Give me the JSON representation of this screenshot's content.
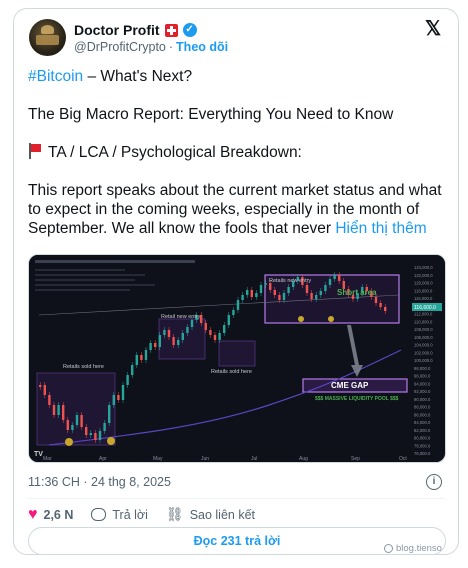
{
  "author": {
    "display_name": "Doctor Profit",
    "handle": "@DrProfitCrypto",
    "follow_label": "Theo dõi",
    "separator": "·"
  },
  "tweet": {
    "hashtag": "#Bitcoin",
    "line1_rest": " – What's Next?",
    "line2": "The Big Macro Report: Everything You Need to Know",
    "line3": "TA / LCA / Psychological Breakdown:",
    "line4": "This report speaks about the current market status and what to expect in the coming weeks, especially in the month of September. We all know the fools that never ",
    "show_more": "Hiển thị thêm"
  },
  "chart": {
    "labels": {
      "retail_sold_here_left": "Retails sold here",
      "retail_new_entry_mid": "Retail new entry",
      "retails_sold_here_mid": "Retails sold here",
      "retails_new_entry_top": "Retails new entry",
      "short_area": "Short area",
      "cme_gap": "CME GAP",
      "liquidity_pool": "$$$ MASSIVE LIQUIDITY POOL $$$"
    },
    "price_ticks": [
      "124,000.0",
      "122,000.0",
      "120,000.0",
      "118,000.0",
      "116,000.0",
      "114,000.0",
      "112,000.0",
      "110,000.0",
      "108,000.0",
      "106,000.0",
      "104,000.0",
      "102,000.0",
      "100,000.0",
      "98,000.0",
      "96,000.0",
      "94,000.0",
      "92,000.0",
      "90,000.0",
      "88,000.0",
      "86,000.0",
      "84,000.0",
      "82,000.0",
      "80,000.0",
      "78,000.0",
      "76,000.0"
    ],
    "time_ticks": [
      "Mar",
      "Apr",
      "May",
      "Jun",
      "Jul",
      "Aug",
      "Sep",
      "Oct"
    ],
    "current_price": "116,600.0",
    "colors": {
      "up": "#26a69a",
      "down": "#ef5350",
      "box": "#7b3fbf",
      "label_green": "#4caf50"
    }
  },
  "meta": {
    "timestamp": "11:36 CH · 24 thg 8, 2025"
  },
  "actions": {
    "likes": "2,6 N",
    "reply_label": "Trả lời",
    "copy_link_label": "Sao liên kết",
    "read_replies": "Đọc 231 trả lời"
  },
  "watermark": "blog.tienso"
}
